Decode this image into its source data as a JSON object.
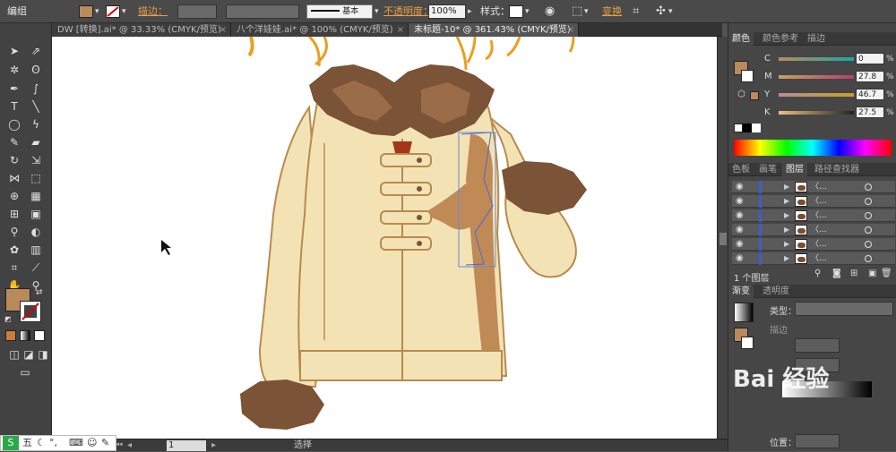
{
  "control_bar": {
    "mode_label": "编组",
    "stroke_label": "描边：",
    "stroke_style": "基本",
    "opacity_label": "不透明度：",
    "opacity_value": "100%",
    "style_label": "样式：",
    "transform_label": "变换"
  },
  "tabs": [
    {
      "label": "DW [转换].ai* @ 33.33% (CMYK/预览)",
      "close": "×"
    },
    {
      "label": "八个洋娃娃.ai* @ 100% (CMYK/预览)",
      "close": "×"
    },
    {
      "label": "未标题-10* @ 361.43% (CMYK/预览)",
      "close": "×"
    }
  ],
  "status": {
    "zoom": "361.43%",
    "page": "1",
    "tool": "选择"
  },
  "color_panel": {
    "tabs": [
      "颜色",
      "颜色参考",
      "描边"
    ],
    "channels": [
      {
        "key": "C",
        "value": "0",
        "unit": "%",
        "pos": 0.0
      },
      {
        "key": "M",
        "value": "27.8",
        "unit": "%",
        "pos": 0.278
      },
      {
        "key": "Y",
        "value": "46.7",
        "unit": "%",
        "pos": 0.467
      },
      {
        "key": "K",
        "value": "27.5",
        "unit": "%",
        "pos": 0.275
      }
    ],
    "fill_color": "#b88a5c"
  },
  "layers_panel": {
    "tabs": [
      "色板",
      "画笔",
      "图层",
      "路径查找器"
    ],
    "row_label": "〈...",
    "row_count": 6,
    "footer_label": "1 个图层"
  },
  "gradient_panel": {
    "tabs": [
      "渐变",
      "透明度"
    ],
    "type_label": "类型：",
    "stroke_label": "描边",
    "position_label": "位置："
  },
  "taskbar": {
    "ime_label": "五"
  },
  "watermark": "Bai 经验",
  "colors": {
    "jacket": "#f3e3b4",
    "fur": "#7b5337",
    "shadow": "#c08a57",
    "outline": "#b98a4e",
    "accent_orange": "#e8a045"
  }
}
